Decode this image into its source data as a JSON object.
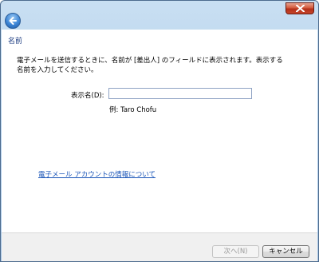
{
  "window": {
    "close_label": "close"
  },
  "page": {
    "heading": "名前",
    "description_line1": "電子メールを送信するときに、名前が [差出人] のフィールドに表示されます。表示する",
    "description_line2": "名前を入力してください。",
    "display_name_label": "表示名(D):",
    "display_name_value": "",
    "example_text": "例: Taro Chofu",
    "help_link": "電子メール アカウントの情報について"
  },
  "footer": {
    "next_label": "次へ(N)",
    "cancel_label": "キャンセル"
  },
  "colors": {
    "heading": "#1e3d82",
    "link": "#1a55b8",
    "close_button": "#c7452a",
    "back_button": "#3d86d6"
  },
  "icons": {
    "back": "back-arrow-icon",
    "close": "close-x-icon"
  }
}
